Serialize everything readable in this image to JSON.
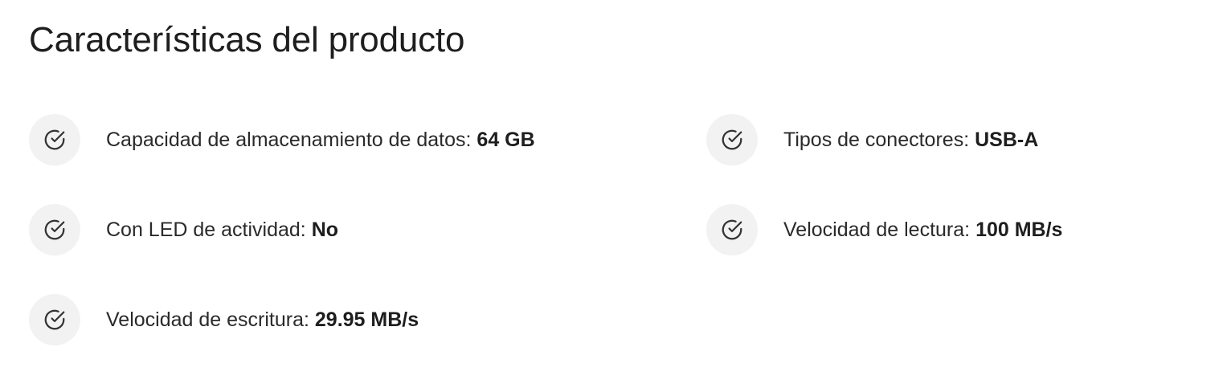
{
  "title": "Características del producto",
  "icon": "check-circle-icon",
  "features": [
    {
      "label": "Capacidad de almacenamiento de datos:",
      "value": "64 GB"
    },
    {
      "label": "Tipos de conectores:",
      "value": "USB-A"
    },
    {
      "label": "Con LED de actividad:",
      "value": "No"
    },
    {
      "label": "Velocidad de lectura:",
      "value": "100 MB/s"
    },
    {
      "label": "Velocidad de escritura:",
      "value": "29.95 MB/s"
    }
  ]
}
